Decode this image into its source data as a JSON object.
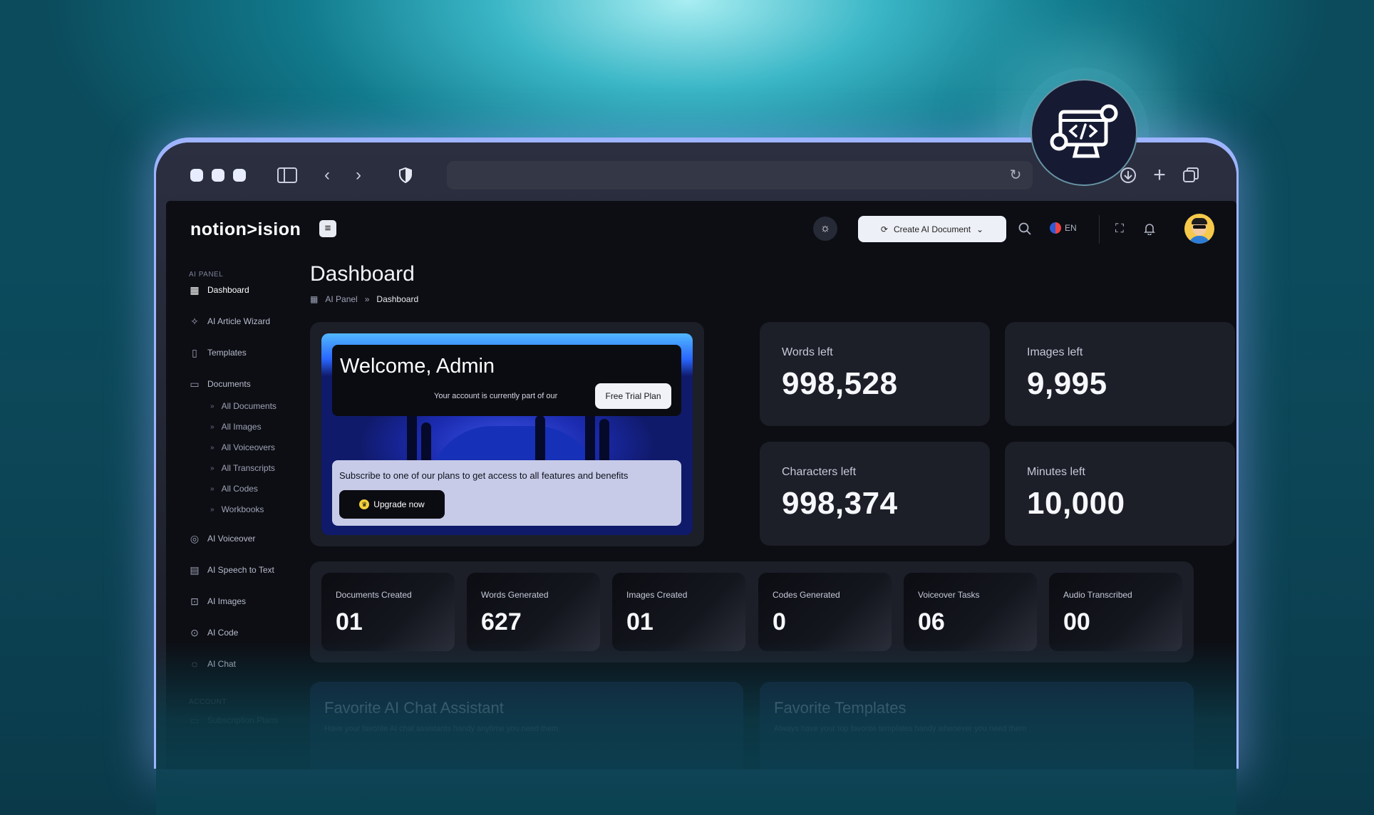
{
  "browser": {
    "icons": [
      "sidebar-toggle-icon",
      "back-arrow-icon",
      "forward-arrow-icon",
      "shield-icon",
      "refresh-icon",
      "download-icon",
      "plus-icon",
      "tabs-icon"
    ]
  },
  "app": {
    "logo": "notion>ision",
    "topbar": {
      "create_button": "Create AI Document",
      "language": "EN"
    },
    "sidebar": {
      "section_ai_panel": "AI PANEL",
      "items": {
        "dashboard": "Dashboard",
        "article_wizard": "AI Article Wizard",
        "templates": "Templates",
        "documents": "Documents",
        "voiceover": "AI Voiceover",
        "speech_to_text": "AI Speech to Text",
        "images": "AI Images",
        "code": "AI Code",
        "chat": "AI Chat"
      },
      "document_subitems": [
        "All Documents",
        "All Images",
        "All Voiceovers",
        "All Transcripts",
        "All Codes",
        "Workbooks"
      ],
      "section_account": "ACCOUNT",
      "account_items": {
        "subscription_plans": "Subscription Plans"
      }
    },
    "main": {
      "title": "Dashboard",
      "breadcrumb": [
        "AI Panel",
        "Dashboard"
      ],
      "welcome": {
        "title": "Welcome, Admin",
        "text": "Your account is currently part of our",
        "plan_button": "Free Trial Plan",
        "subscribe_text": "Subscribe to one of our plans to get access to all features and benefits",
        "upgrade_button": "Upgrade now"
      },
      "stats": {
        "words": {
          "label": "Words left",
          "value": "998,528"
        },
        "images": {
          "label": "Images left",
          "value": "9,995"
        },
        "characters": {
          "label": "Characters left",
          "value": "998,374"
        },
        "minutes": {
          "label": "Minutes left",
          "value": "10,000"
        }
      },
      "counts": {
        "documents": {
          "label": "Documents Created",
          "value": "01"
        },
        "words": {
          "label": "Words Generated",
          "value": "627"
        },
        "images": {
          "label": "Images Created",
          "value": "01"
        },
        "codes": {
          "label": "Codes Generated",
          "value": "0"
        },
        "voiceover": {
          "label": "Voiceover Tasks",
          "value": "06"
        },
        "audio": {
          "label": "Audio Transcribed",
          "value": "00"
        }
      },
      "favorites": {
        "chat": {
          "title": "Favorite AI Chat Assistant",
          "subtitle": "Have your favorite AI chat assistants handy anytime you need them"
        },
        "templates": {
          "title": "Favorite Templates",
          "subtitle": "Always have your top favorite templates handy whenever you need them"
        }
      }
    }
  },
  "colors": {
    "accent_light": "#eef0f7",
    "background": "#0d0e14",
    "card": "#1c1e28",
    "badge": "#161a33"
  }
}
